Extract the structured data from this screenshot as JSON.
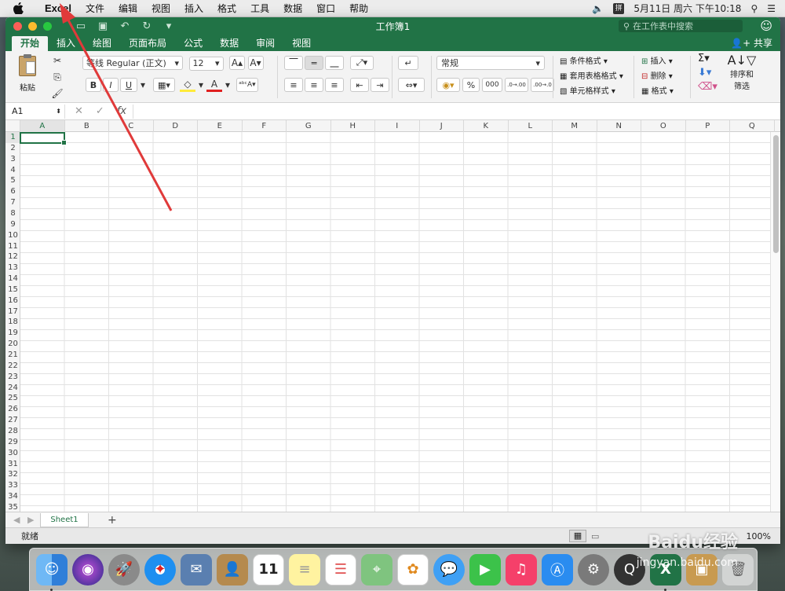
{
  "menubar": {
    "app": "Excel",
    "items": [
      "文件",
      "编辑",
      "视图",
      "插入",
      "格式",
      "工具",
      "数据",
      "窗口",
      "帮助"
    ],
    "clock": "5月11日 周六 下午10:18"
  },
  "window": {
    "title": "工作簿1",
    "search_placeholder": "在工作表中搜索",
    "share": "共享"
  },
  "tabs": [
    "开始",
    "插入",
    "绘图",
    "页面布局",
    "公式",
    "数据",
    "审阅",
    "视图"
  ],
  "ribbon": {
    "paste": "粘贴",
    "font_name": "等线 Regular (正文)",
    "font_size": "12",
    "number_format": "常规",
    "conditional": "条件格式",
    "table_format": "套用表格格式",
    "cell_style": "单元格样式",
    "insert": "插入",
    "delete": "删除",
    "format": "格式",
    "sort_filter_1": "排序和",
    "sort_filter_2": "筛选",
    "percent": "%",
    "thousands": "000",
    "dec_inc": ".0→.00",
    "dec_dec": ".00→.0",
    "bold": "B",
    "italic": "I",
    "underline": "U",
    "fx": "fx"
  },
  "formula_bar": {
    "name_box": "A1",
    "value": ""
  },
  "columns": [
    "A",
    "B",
    "C",
    "D",
    "E",
    "F",
    "G",
    "H",
    "I",
    "J",
    "K",
    "L",
    "M",
    "N",
    "O",
    "P",
    "Q"
  ],
  "rows": [
    "1",
    "2",
    "3",
    "4",
    "5",
    "6",
    "7",
    "8",
    "9",
    "10",
    "11",
    "12",
    "13",
    "14",
    "15",
    "16",
    "17",
    "18",
    "19",
    "20",
    "21",
    "22",
    "23",
    "24",
    "25",
    "26",
    "27",
    "28",
    "29",
    "30",
    "31",
    "32",
    "33",
    "34",
    "35"
  ],
  "sheet": {
    "tab": "Sheet1",
    "add": "+"
  },
  "status": {
    "text": "就绪",
    "zoom": "100%"
  },
  "watermark": {
    "brand": "Baidu经验",
    "url": "jingyan.baidu.com"
  },
  "colors": {
    "excel_green": "#217346",
    "arrow_red": "#e03a3a"
  }
}
